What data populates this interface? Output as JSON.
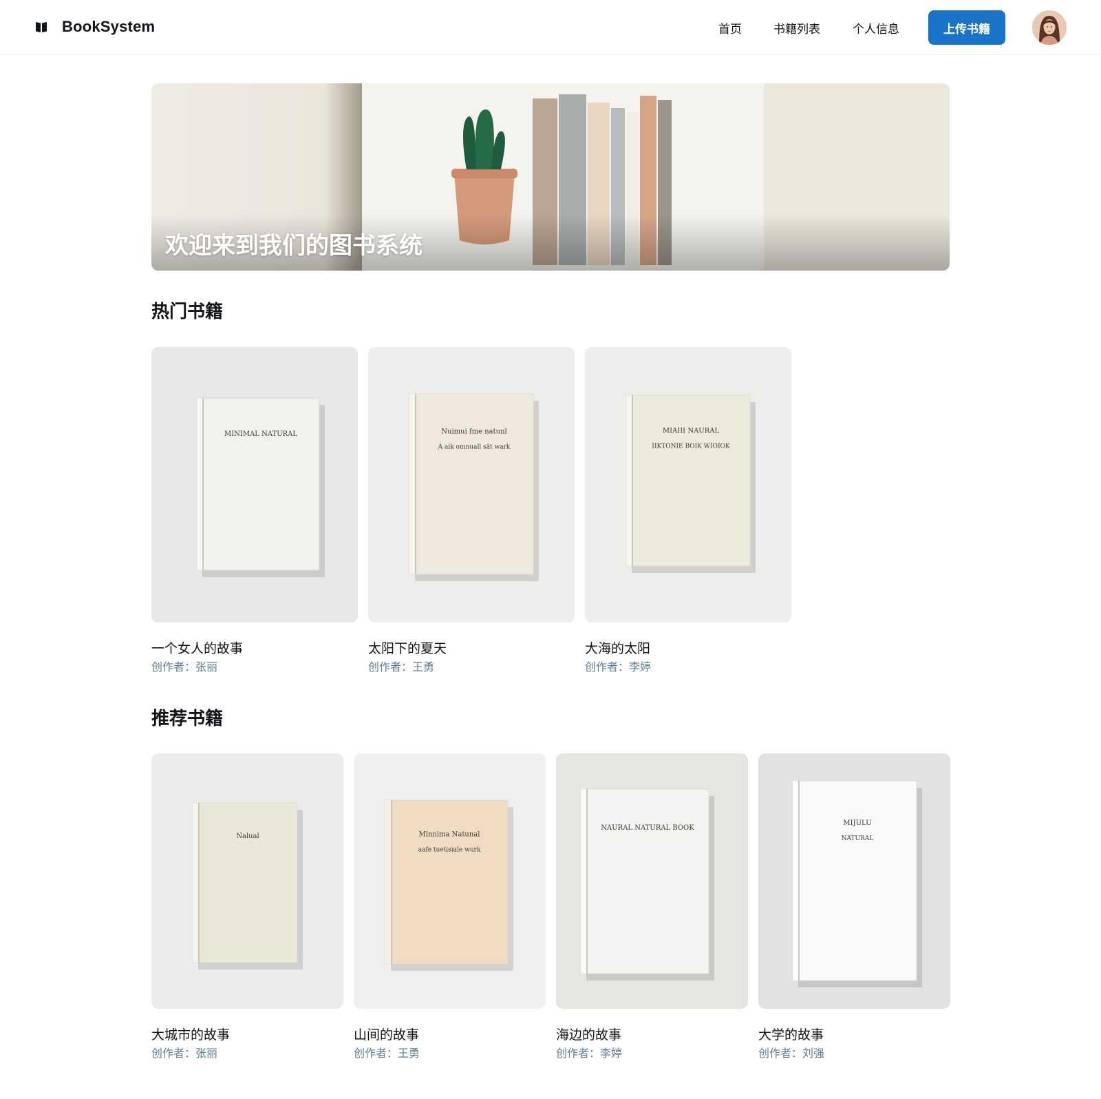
{
  "header": {
    "brand": "BookSystem",
    "nav": [
      {
        "label": "首页"
      },
      {
        "label": "书籍列表"
      },
      {
        "label": "个人信息"
      }
    ],
    "upload_label": "上传书籍"
  },
  "hero": {
    "title": "欢迎来到我们的图书系统"
  },
  "popular": {
    "title": "热门书籍",
    "books": [
      {
        "title": "一个女人的故事",
        "author_prefix": "创作者：",
        "author": "张丽",
        "cover_color": "#f1f1ee",
        "cover_text": [
          "MINIMAL NATURAL"
        ]
      },
      {
        "title": "太阳下的夏天",
        "author_prefix": "创作者：",
        "author": "王勇",
        "cover_color": "#efe9dd",
        "cover_text": [
          "Nuimui fme natunl",
          "A aik omnuall sät wark"
        ]
      },
      {
        "title": "大海的太阳",
        "author_prefix": "创作者：",
        "author": "李婷",
        "cover_color": "#efebdb",
        "cover_text": [
          "MIAIII NAURAL",
          "IIKTONIE BOIK WIOIOK"
        ]
      }
    ]
  },
  "recommended": {
    "title": "推荐书籍",
    "books": [
      {
        "title": "大城市的故事",
        "author_prefix": "创作者：",
        "author": "张丽",
        "cover_color": "#e9e8d6",
        "cover_text": [
          "Nalual"
        ]
      },
      {
        "title": "山间的故事",
        "author_prefix": "创作者：",
        "author": "王勇",
        "cover_color": "#efdcc2",
        "cover_text": [
          "Minnima Natunal",
          "aafe tuetisiale wurk"
        ]
      },
      {
        "title": "海边的故事",
        "author_prefix": "创作者：",
        "author": "李婷",
        "cover_color": "#f4f4f2",
        "cover_text": [
          "NAURAL NATURAL BOOK"
        ]
      },
      {
        "title": "大学的故事",
        "author_prefix": "创作者：",
        "author": "刘强",
        "cover_color": "#fafafa",
        "cover_text": [
          "MIJULU",
          "NATURAL"
        ]
      }
    ]
  },
  "colors": {
    "accent": "#1a73c9",
    "author_text": "#5f7c98"
  },
  "icons": {
    "logo": "book-icon",
    "avatar": "user-avatar"
  }
}
